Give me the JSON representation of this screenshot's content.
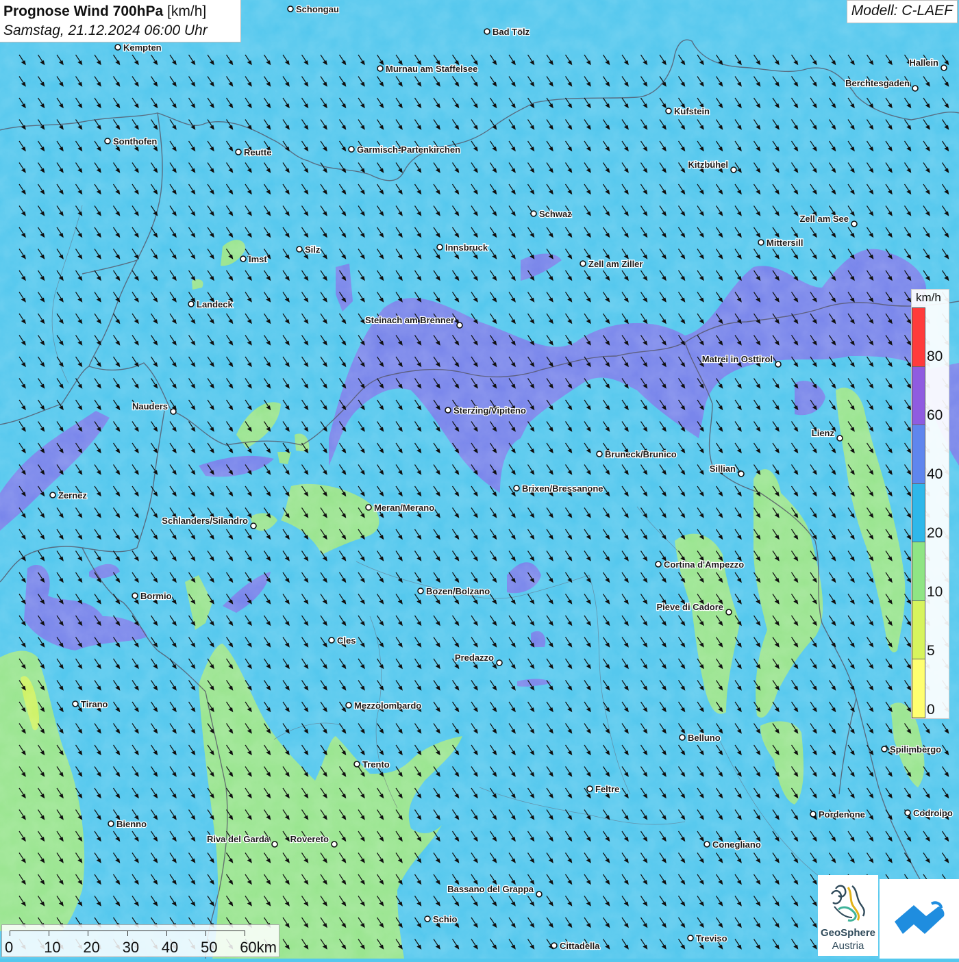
{
  "header": {
    "title_bold": "Prognose Wind 700hPa",
    "title_unit": "[km/h]",
    "datetime": "Samstag, 21.12.2024 06:00 Uhr",
    "model": "Modell: C-LAEF"
  },
  "legend": {
    "unit": "km/h",
    "labels": [
      "80",
      "60",
      "40",
      "20",
      "10",
      "5",
      "0"
    ],
    "colors": [
      "#ff3b3b",
      "#8f5ce0",
      "#5f86ee",
      "#2fb8ea",
      "#8fe585",
      "#d7f45e",
      "#ffff70"
    ]
  },
  "scalebar": {
    "labels": [
      "0",
      "10",
      "20",
      "30",
      "40",
      "50",
      "60km"
    ]
  },
  "logo": {
    "name": "GeoSphere",
    "country": "Austria"
  },
  "map": {
    "wind_direction": "northwest-to-southeast",
    "colors": {
      "sea_cyan": "#55c8ee",
      "violet_band": "#7b83ea",
      "green_calm": "#9de58c",
      "border": "#555566"
    }
  },
  "cities": [
    {
      "name": "Schongau"
    },
    {
      "name": "Bad Tölz"
    },
    {
      "name": "Kempten"
    },
    {
      "name": "Murnau am Staffelsee"
    },
    {
      "name": "Hallein"
    },
    {
      "name": "Berchtesgaden"
    },
    {
      "name": "Kufstein"
    },
    {
      "name": "Sonthofen"
    },
    {
      "name": "Reutte"
    },
    {
      "name": "Garmisch-Partenkirchen"
    },
    {
      "name": "Kitzbühel"
    },
    {
      "name": "Schwaz"
    },
    {
      "name": "Zell am See"
    },
    {
      "name": "Mittersill"
    },
    {
      "name": "Innsbruck"
    },
    {
      "name": "Silz"
    },
    {
      "name": "Imst"
    },
    {
      "name": "Zell am Ziller"
    },
    {
      "name": "Landeck"
    },
    {
      "name": "Steinach am Brenner"
    },
    {
      "name": "Matrei in Osttirol"
    },
    {
      "name": "Nauders"
    },
    {
      "name": "Sterzing/Vipiteno"
    },
    {
      "name": "Lienz"
    },
    {
      "name": "Bruneck/Brunico"
    },
    {
      "name": "Sillian"
    },
    {
      "name": "Brixen/Bressanone"
    },
    {
      "name": "Zernez"
    },
    {
      "name": "Meran/Merano"
    },
    {
      "name": "Schlanders/Silandro"
    },
    {
      "name": "Cortina d'Ampezzo"
    },
    {
      "name": "Bozen/Bolzano"
    },
    {
      "name": "Bormio"
    },
    {
      "name": "Pieve di Cadore"
    },
    {
      "name": "Cles"
    },
    {
      "name": "Predazzo"
    },
    {
      "name": "Tirano"
    },
    {
      "name": "Mezzolombardo"
    },
    {
      "name": "Belluno"
    },
    {
      "name": "Spilimbergo"
    },
    {
      "name": "Trento"
    },
    {
      "name": "Feltre"
    },
    {
      "name": "Pordenone"
    },
    {
      "name": "Codroipo"
    },
    {
      "name": "Bienno"
    },
    {
      "name": "Riva del Garda"
    },
    {
      "name": "Rovereto"
    },
    {
      "name": "Conegliano"
    },
    {
      "name": "Bassano del Grappa"
    },
    {
      "name": "Schio"
    },
    {
      "name": "Treviso"
    },
    {
      "name": "Cittadella"
    }
  ]
}
